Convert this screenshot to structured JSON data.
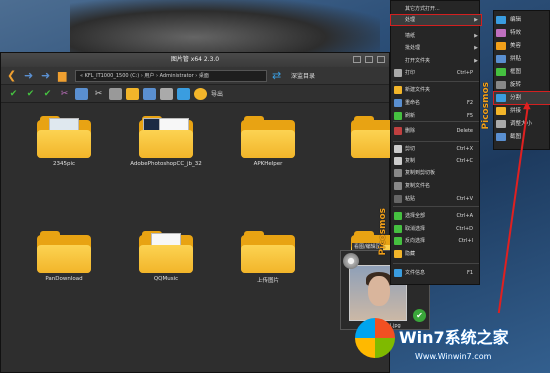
{
  "window": {
    "title": "图片管 x64 2.3.0"
  },
  "address": {
    "path": "« KFL_IT1000_1500 (C:) › 用户 › Administrator › 桌面",
    "monitor_label": "深监目录",
    "export_label": "导出"
  },
  "folders": [
    {
      "label": "2345pic"
    },
    {
      "label": "AdobePhotoshopCC_jb_32"
    },
    {
      "label": "APKHelper"
    },
    {
      "label": "PanDownload"
    },
    {
      "label": "QQMusic"
    },
    {
      "label": "上传图片"
    }
  ],
  "image_card": {
    "tip": "看图/编辑区",
    "filename": "timg (1).jpg"
  },
  "menu": {
    "brand": "Picosmos",
    "items": [
      {
        "label": "其它方式打开...",
        "shortcut": "",
        "arrow": false
      },
      {
        "label": "处理",
        "shortcut": "",
        "arrow": true,
        "highlight": true
      },
      {
        "label": "墙纸",
        "shortcut": "",
        "arrow": true
      },
      {
        "label": "批处理",
        "shortcut": "",
        "arrow": true
      },
      {
        "label": "打开文件夹",
        "shortcut": "",
        "arrow": true
      },
      {
        "label": "打印",
        "shortcut": "Ctrl+P",
        "arrow": false
      },
      {
        "label": "新建文件夹",
        "shortcut": "",
        "arrow": false
      },
      {
        "label": "重命名",
        "shortcut": "F2",
        "arrow": false
      },
      {
        "label": "刷新",
        "shortcut": "F5",
        "arrow": false
      },
      {
        "label": "删除",
        "shortcut": "Delete",
        "arrow": false
      },
      {
        "label": "剪切",
        "shortcut": "Ctrl+X",
        "arrow": false
      },
      {
        "label": "复制",
        "shortcut": "Ctrl+C",
        "arrow": false
      },
      {
        "label": "复制到剪切板",
        "shortcut": "",
        "arrow": false
      },
      {
        "label": "复制文件名",
        "shortcut": "",
        "arrow": false
      },
      {
        "label": "粘贴",
        "shortcut": "Ctrl+V",
        "arrow": false
      },
      {
        "label": "选择全部",
        "shortcut": "Ctrl+A",
        "arrow": false
      },
      {
        "label": "取消选择",
        "shortcut": "Ctrl+D",
        "arrow": false
      },
      {
        "label": "反向选择",
        "shortcut": "Ctrl+I",
        "arrow": false
      },
      {
        "label": "隐藏",
        "shortcut": "",
        "arrow": false
      },
      {
        "label": "文件信息",
        "shortcut": "F1",
        "arrow": false
      }
    ]
  },
  "submenu": {
    "items": [
      {
        "label": "编辑"
      },
      {
        "label": "特效"
      },
      {
        "label": "美容"
      },
      {
        "label": "拼贴"
      },
      {
        "label": "框图"
      },
      {
        "label": "旋转"
      },
      {
        "label": "分割",
        "highlight": true
      },
      {
        "label": "拼接"
      },
      {
        "label": "调整大小"
      },
      {
        "label": "截图"
      }
    ]
  },
  "watermark": {
    "title": "Win7系统之家",
    "url": "Www.Winwin7.com"
  },
  "colors": {
    "accent": "#f2a01a",
    "highlight": "#d42020",
    "folder": "#f2b52a"
  }
}
